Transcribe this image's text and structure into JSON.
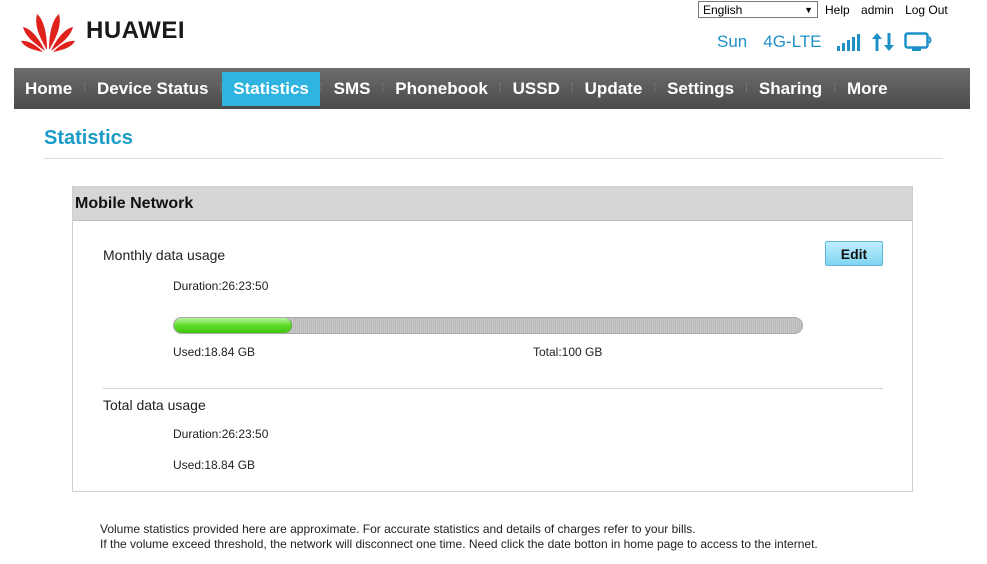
{
  "brand": {
    "name": "HUAWEI",
    "logo_color": "#e0201b"
  },
  "top": {
    "language": "English",
    "links": [
      "Help",
      "admin",
      "Log Out"
    ]
  },
  "status": {
    "operator": "Sun",
    "network": "4G-LTE",
    "icons": [
      "signal-bars-icon",
      "data-transfer-icon",
      "connected-pc-icon"
    ],
    "accent": "#1e90c8"
  },
  "nav": {
    "items": [
      {
        "label": "Home"
      },
      {
        "label": "Device Status"
      },
      {
        "label": "Statistics",
        "active": true
      },
      {
        "label": "SMS"
      },
      {
        "label": "Phonebook"
      },
      {
        "label": "USSD"
      },
      {
        "label": "Update"
      },
      {
        "label": "Settings"
      },
      {
        "label": "Sharing"
      },
      {
        "label": "More"
      }
    ],
    "active_color": "#2fb4e0"
  },
  "page": {
    "title": "Statistics"
  },
  "mobile_network": {
    "heading": "Mobile Network",
    "monthly": {
      "label": "Monthly data usage",
      "edit_label": "Edit",
      "duration": "Duration:26:23:50",
      "used": "Used:18.84 GB",
      "total": "Total:100 GB",
      "used_fraction": 0.1884
    },
    "total": {
      "label": "Total data usage",
      "duration": "Duration:26:23:50",
      "used": "Used:18.84 GB"
    }
  },
  "footer": {
    "line1": "Volume statistics provided here are approximate. For accurate statistics and details of charges refer to your bills.",
    "line2": "If the volume exceed threshold, the network will disconnect one time. Need click the date botton in home page to access to the internet."
  }
}
